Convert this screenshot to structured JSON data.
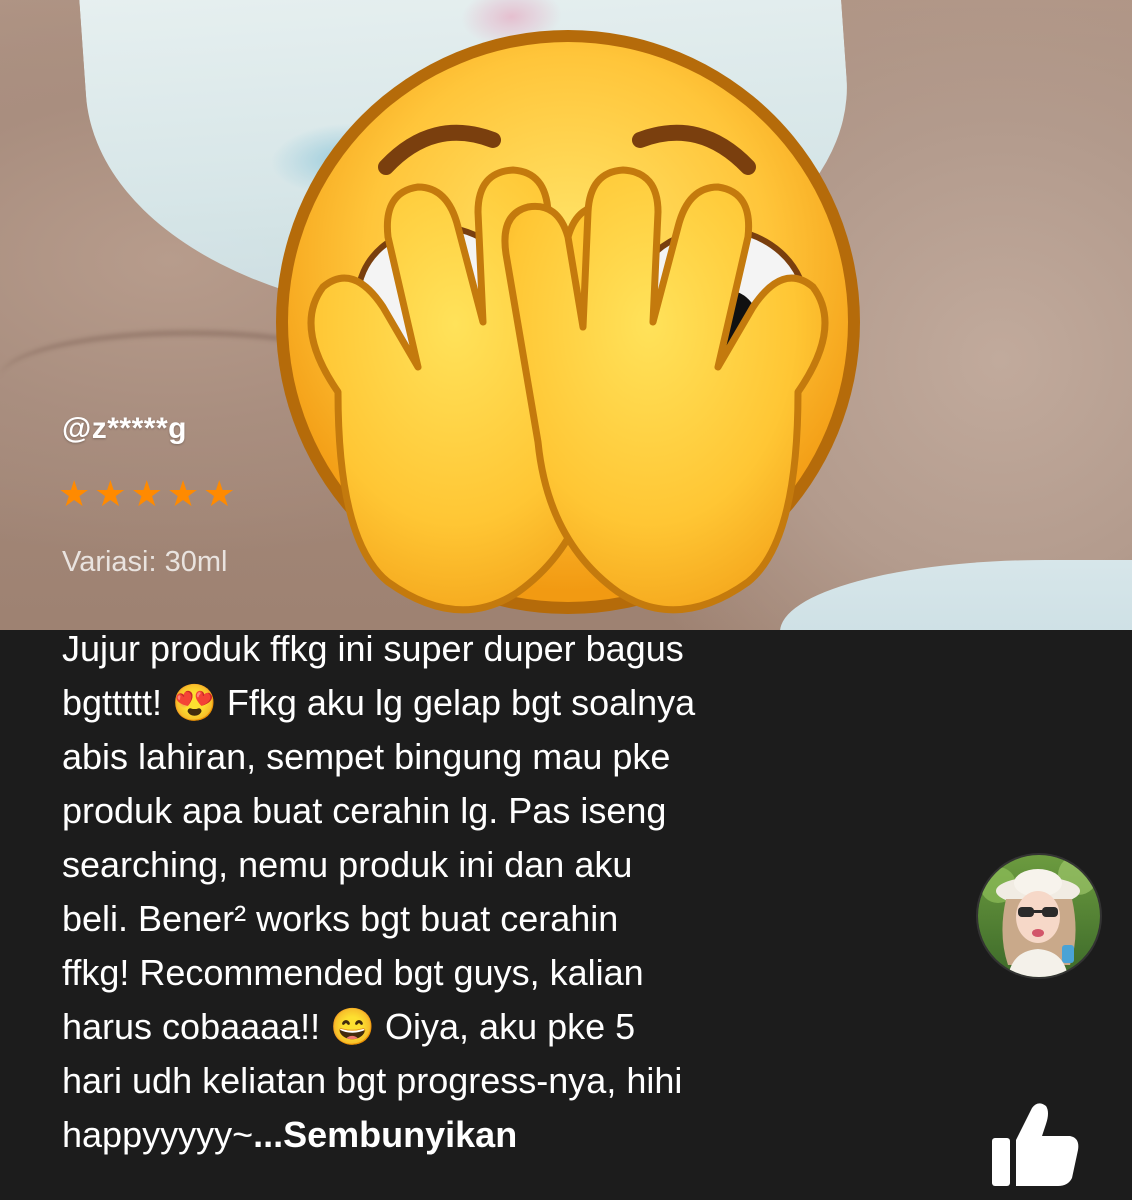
{
  "review": {
    "username": "@z*****g",
    "rating": 5,
    "variant_label": "Variasi: 30ml",
    "text": "Jujur produk ffkg ini super duper bagus\nbgttttt! 😍 Ffkg aku lg gelap bgt soalnya\nabis lahiran, sempet bingung mau pke\nproduk apa buat cerahin lg. Pas iseng\nsearching, nemu produk ini dan aku\nbeli. Bener² works bgt buat cerahin\nffkg! Recommended bgt guys, kalian\nharus cobaaaa!! 😄 Oiya, aku pke 5\nhari udh keliatan bgt progress-nya, hihi\nhappyyyyy~",
    "hide_link": "...Sembunyikan"
  },
  "icons": {
    "stars": "star-icon",
    "emoji": "face-covering-eyes-emoji",
    "avatar": "avatar",
    "like": "thumbs-up-icon"
  },
  "colors": {
    "background": "#1c1c1c",
    "star": "#ff8a00",
    "text": "#ffffff"
  }
}
